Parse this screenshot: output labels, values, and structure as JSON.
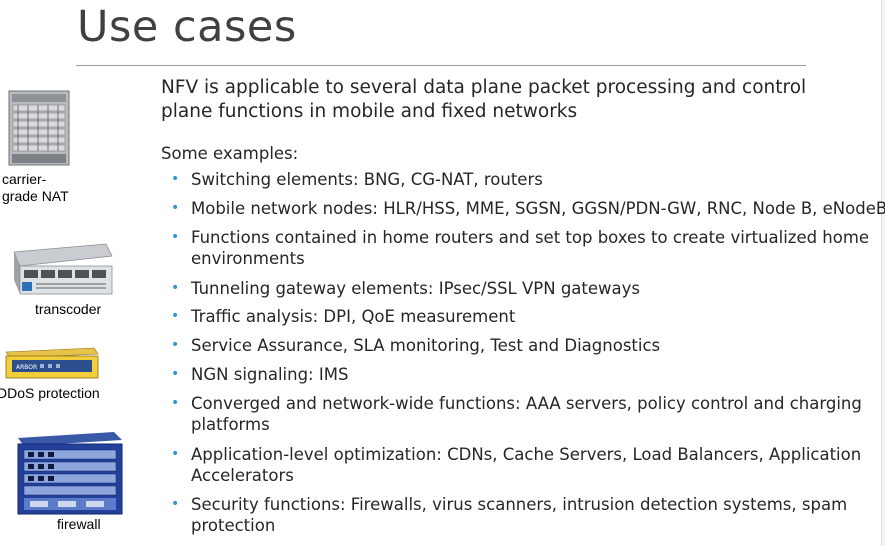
{
  "slide": {
    "title": "Use cases",
    "intro": "NFV is applicable to several data plane packet processing and control plane functions in mobile and fixed networks",
    "examples_heading": "Some examples:",
    "bullet_color": "#2f97d8",
    "bullets": [
      {
        "text": "Switching elements: BNG, CG-NAT, routers"
      },
      {
        "text": "Mobile network nodes: HLR/HSS, MME, SGSN, GGSN/PDN-GW, RNC, Node B, eNodeB"
      },
      {
        "text": "Functions contained in home routers and set top boxes to create virtualized home environments"
      },
      {
        "text": "Tunneling gateway elements: IPsec/SSL VPN gateways"
      },
      {
        "text": "Traffic analysis: DPI, QoE measurement"
      },
      {
        "text": "Service Assurance, SLA monitoring, Test and Diagnostics"
      },
      {
        "text": "NGN signaling: IMS"
      },
      {
        "text": "Converged and network-wide functions: AAA servers, policy control and charging platforms"
      },
      {
        "text": "Application-level optimization: CDNs, Cache Servers, Load Balancers, Application Accelerators"
      },
      {
        "text": "Security functions: Firewalls, virus scanners, intrusion detection systems, spam protection"
      }
    ]
  },
  "devices": [
    {
      "name": "carrier-grade-nat-chassis",
      "label_line1": "carrier-",
      "label_line2": "grade NAT"
    },
    {
      "name": "transcoder-appliance",
      "label": "transcoder"
    },
    {
      "name": "ddos-protection-appliance",
      "label": "DDoS protection",
      "brand_text": "ARBOR"
    },
    {
      "name": "firewall-chassis",
      "label": "firewall"
    }
  ]
}
